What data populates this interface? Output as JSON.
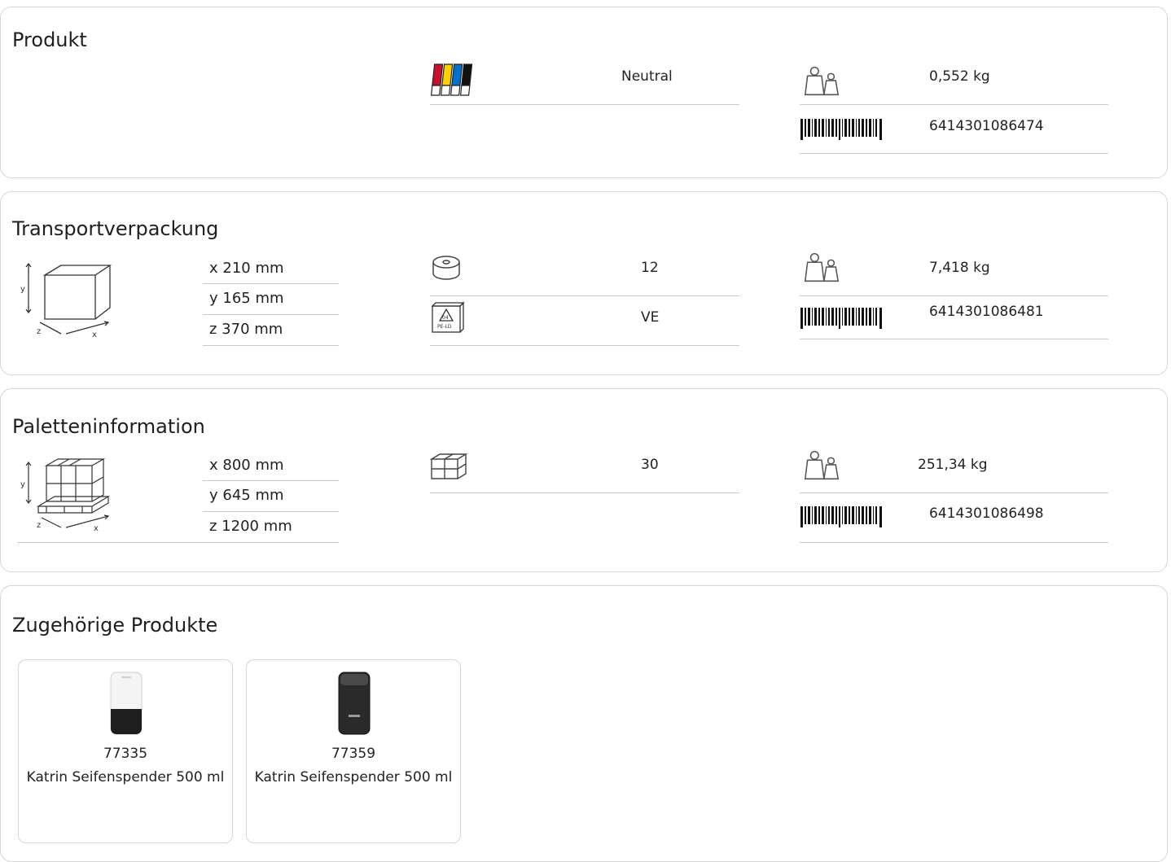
{
  "produkt": {
    "title": "Produkt",
    "color_label": "Neutral",
    "weight": "0,552 kg",
    "ean": "6414301086474",
    "icons": [
      "color-pens-icon",
      "weight-icon",
      "barcode-icon"
    ]
  },
  "transport": {
    "title": "Transportverpackung",
    "x": "x 210 mm",
    "y": "y 165 mm",
    "z": "z 370 mm",
    "quantity": "12",
    "unit": "VE",
    "weight": "7,418 kg",
    "ean": "6414301086481",
    "icons": [
      "box-dimensions-icon",
      "roll-icon",
      "recycle-pe-ld-icon",
      "weight-icon",
      "barcode-icon"
    ]
  },
  "palette": {
    "title": "Paletteninformation",
    "x": "x 800 mm",
    "y": "y 645 mm",
    "z": "z 1200 mm",
    "boxes": "30",
    "weight": "251,34 kg",
    "ean": "6414301086498",
    "icons": [
      "pallet-dimensions-icon",
      "boxes-icon",
      "weight-icon",
      "barcode-icon"
    ]
  },
  "related": {
    "title": "Zugehörige Produkte",
    "items": [
      {
        "code": "77335",
        "name": "Katrin Seifenspender 500 ml",
        "variant": "white"
      },
      {
        "code": "77359",
        "name": "Katrin Seifenspender 500 ml",
        "variant": "black"
      }
    ]
  },
  "colors": {
    "border": "#d6d6d6",
    "divider": "#c8c8c8",
    "pen_red": "#c8102e",
    "pen_yellow": "#ffd100",
    "pen_blue": "#0072ce",
    "pen_black": "#111111"
  }
}
